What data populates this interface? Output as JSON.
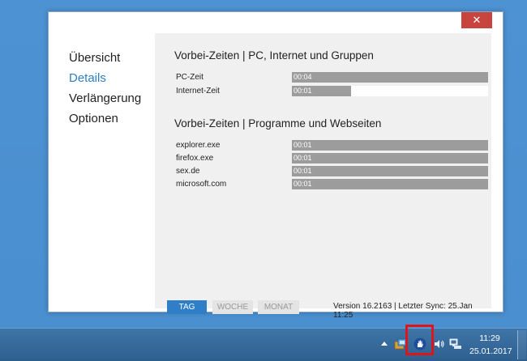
{
  "window": {
    "close_label": "✕"
  },
  "nav": {
    "items": [
      {
        "label": "Übersicht",
        "active": false
      },
      {
        "label": "Details",
        "active": true
      },
      {
        "label": "Verlängerung",
        "active": false
      },
      {
        "label": "Optionen",
        "active": false
      }
    ]
  },
  "section_pc": {
    "title": "Vorbei-Zeiten | PC, Internet und Gruppen",
    "rows": [
      {
        "label": "PC-Zeit",
        "value": "00:04",
        "fill_fraction": 1.0
      },
      {
        "label": "Internet-Zeit",
        "value": "00:01",
        "fill_fraction": 0.3
      }
    ]
  },
  "section_programs": {
    "title": "Vorbei-Zeiten | Programme und Webseiten",
    "rows": [
      {
        "label": "explorer.exe",
        "value": "00:01",
        "fill_fraction": 1.0
      },
      {
        "label": "firefox.exe",
        "value": "00:01",
        "fill_fraction": 1.0
      },
      {
        "label": "sex.de",
        "value": "00:01",
        "fill_fraction": 1.0
      },
      {
        "label": "microsoft.com",
        "value": "00:01",
        "fill_fraction": 1.0
      }
    ]
  },
  "footer": {
    "tab_day": "TAG",
    "tab_week": "WOCHE",
    "tab_month": "MONAT",
    "version": "Version 16.2163 | Letzter Sync: 25.Jan 11:25"
  },
  "taskbar": {
    "time": "11:29",
    "date": "25.01.2017",
    "icons": [
      "show-hidden-icons-arrow",
      "network-app-icon",
      "hand-shield-icon",
      "speaker-icon",
      "network-icon"
    ]
  },
  "colors": {
    "accent": "#2e7fc7",
    "bar": "#9c9c9c",
    "close": "#c7453e",
    "highlight": "#e0151a"
  }
}
